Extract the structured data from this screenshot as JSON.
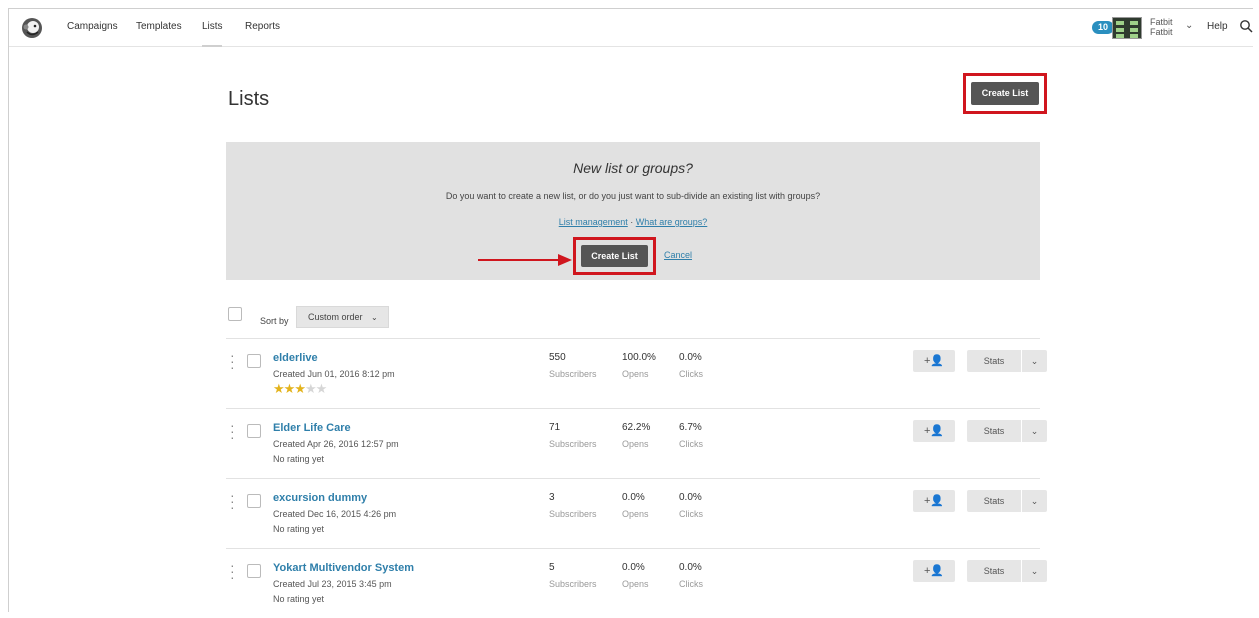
{
  "nav": {
    "items": [
      "Campaigns",
      "Templates",
      "Lists",
      "Reports"
    ],
    "notification_count": "10",
    "account_name": "Fatbit",
    "account_org": "Fatbit",
    "help_label": "Help"
  },
  "page": {
    "title": "Lists",
    "create_button": "Create List"
  },
  "panel": {
    "title": "New list or groups?",
    "description": "Do you want to create a new list, or do you just want to sub-divide an existing list with groups?",
    "link_management": "List management",
    "link_separator": " · ",
    "link_groups": "What are groups?",
    "create_button": "Create List",
    "cancel_label": "Cancel"
  },
  "sort": {
    "label": "Sort by",
    "selected": "Custom order"
  },
  "lists": [
    {
      "name": "elderlive",
      "created": "Created Jun 01, 2016 8:12 pm",
      "rating_text": "",
      "stars": 3,
      "subscribers": "550",
      "opens": "100.0%",
      "clicks": "0.0%"
    },
    {
      "name": "Elder Life Care",
      "created": "Created Apr 26, 2016 12:57 pm",
      "rating_text": "No rating yet",
      "stars": 0,
      "subscribers": "71",
      "opens": "62.2%",
      "clicks": "6.7%"
    },
    {
      "name": "excursion dummy",
      "created": "Created Dec 16, 2015 4:26 pm",
      "rating_text": "No rating yet",
      "stars": 0,
      "subscribers": "3",
      "opens": "0.0%",
      "clicks": "0.0%"
    },
    {
      "name": "Yokart Multivendor System",
      "created": "Created Jul 23, 2015 3:45 pm",
      "rating_text": "No rating yet",
      "stars": 0,
      "subscribers": "5",
      "opens": "0.0%",
      "clicks": "0.0%"
    }
  ],
  "labels": {
    "subscribers": "Subscribers",
    "opens": "Opens",
    "clicks": "Clicks",
    "stats_button": "Stats",
    "add_icon": "+👤"
  },
  "colors": {
    "link": "#2f7faa",
    "highlight": "#d0161e",
    "star": "#e3b31c",
    "badge": "#2a8fbf"
  }
}
